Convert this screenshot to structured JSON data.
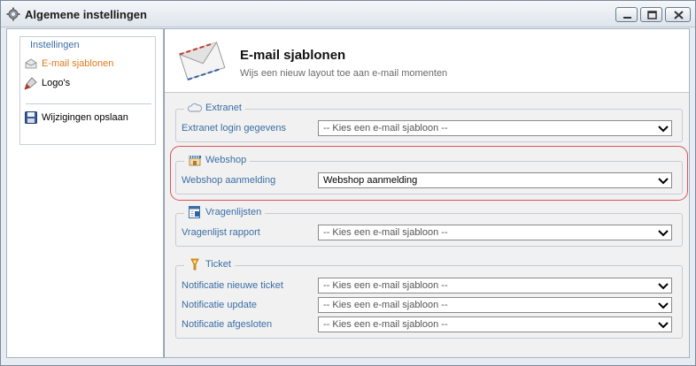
{
  "window": {
    "title": "Algemene instellingen"
  },
  "sidebar": {
    "group_title": "Instellingen",
    "items": [
      {
        "label": "E-mail sjablonen",
        "icon": "email-icon",
        "active": true
      },
      {
        "label": "Logo's",
        "icon": "brush-icon",
        "active": false
      },
      {
        "label": "Wijzigingen opslaan",
        "icon": "save-icon",
        "active": false
      }
    ]
  },
  "header": {
    "title": "E-mail sjablonen",
    "subtitle": "Wijs een nieuw layout toe aan e-mail momenten"
  },
  "sections": [
    {
      "legend": "Extranet",
      "icon": "cloud-icon",
      "rows": [
        {
          "label": "Extranet login gegevens",
          "value": "-- Kies een e-mail sjabloon --"
        }
      ]
    },
    {
      "legend": "Webshop",
      "icon": "shop-icon",
      "highlighted": true,
      "rows": [
        {
          "label": "Webshop aanmelding",
          "value": "Webshop aanmelding"
        }
      ]
    },
    {
      "legend": "Vragenlijsten",
      "icon": "form-icon",
      "rows": [
        {
          "label": "Vragenlijst rapport",
          "value": "-- Kies een e-mail sjabloon --"
        }
      ]
    },
    {
      "legend": "Ticket",
      "icon": "ticket-icon",
      "rows": [
        {
          "label": "Notificatie nieuwe ticket",
          "value": "-- Kies een e-mail sjabloon --"
        },
        {
          "label": "Notificatie update",
          "value": "-- Kies een e-mail sjabloon --"
        },
        {
          "label": "Notificatie afgesloten",
          "value": "-- Kies een e-mail sjabloon --"
        }
      ]
    }
  ],
  "colors": {
    "accent_link": "#3b6ea5",
    "active_item": "#e07a1b",
    "highlight": "#d9545a"
  }
}
